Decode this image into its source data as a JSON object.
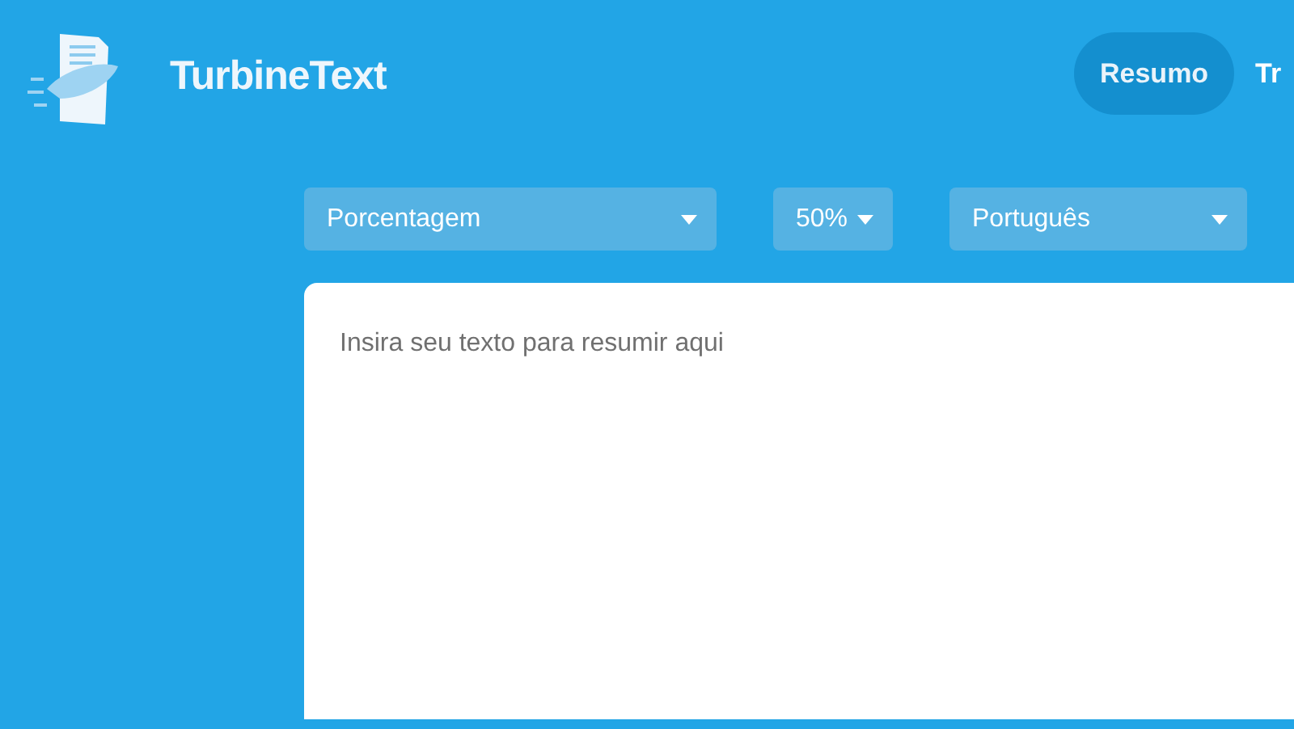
{
  "brand": {
    "name": "TurbineText"
  },
  "nav": [
    {
      "label": "Resumo",
      "selected": true
    },
    {
      "label": "Tr",
      "selected": false
    }
  ],
  "selects": [
    {
      "kind": "mode",
      "value": "Porcentagem"
    },
    {
      "kind": "ratio",
      "value": "50%"
    },
    {
      "kind": "language",
      "value": "Português"
    }
  ],
  "editor": {
    "placeholder": "Insira seu texto para resumir aqui"
  }
}
